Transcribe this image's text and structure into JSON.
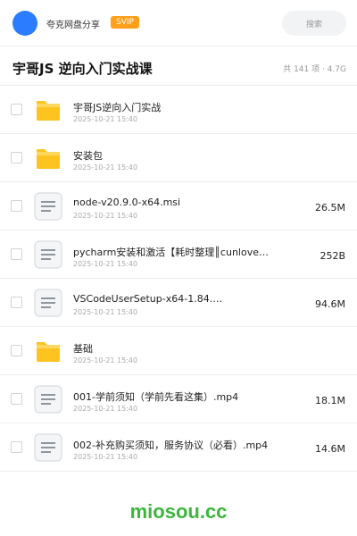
{
  "header": {
    "brand": "夸克网盘分享",
    "badge": "SVIP",
    "search_label": "搜索"
  },
  "page": {
    "title": "宇哥JS 逆向入门实战课",
    "meta": "共 141 项 · 4.7G"
  },
  "files": [
    {
      "type": "folder",
      "name": "宇哥JS逆向入门实战",
      "date": "2025-10-21 15:40",
      "size": ""
    },
    {
      "type": "folder",
      "name": "安装包",
      "date": "2025-10-21 15:40",
      "size": ""
    },
    {
      "type": "file",
      "name": "node-v20.9.0-x64.msi",
      "date": "2025-10-21 15:40",
      "size": "26.5M"
    },
    {
      "type": "file",
      "name": "pycharm安装和激活【耗时整理║cunlove…",
      "date": "2025-10-21 15:40",
      "size": "252B"
    },
    {
      "type": "file",
      "name": "VSCodeUserSetup-x64-1.84.…",
      "date": "2025-10-21 15:40",
      "size": "94.6M"
    },
    {
      "type": "folder",
      "name": "基础",
      "date": "2025-10-21 15:40",
      "size": ""
    },
    {
      "type": "file",
      "name": "001-学前须知（学前先看这集）.mp4",
      "date": "2025-10-21 15:40",
      "size": "18.1M"
    },
    {
      "type": "file",
      "name": "002-补充购买须知，服务协议（必看）.mp4",
      "date": "2025-10-21 15:40",
      "size": "14.6M"
    }
  ],
  "watermark": "miosou.cc",
  "colors": {
    "avatar": "#2b7cff",
    "badge": "#ff9f1a",
    "folder": "#ffc31f",
    "watermark": "#3cb63c"
  },
  "icons": {
    "folder": "folder-icon",
    "file": "document-icon"
  }
}
